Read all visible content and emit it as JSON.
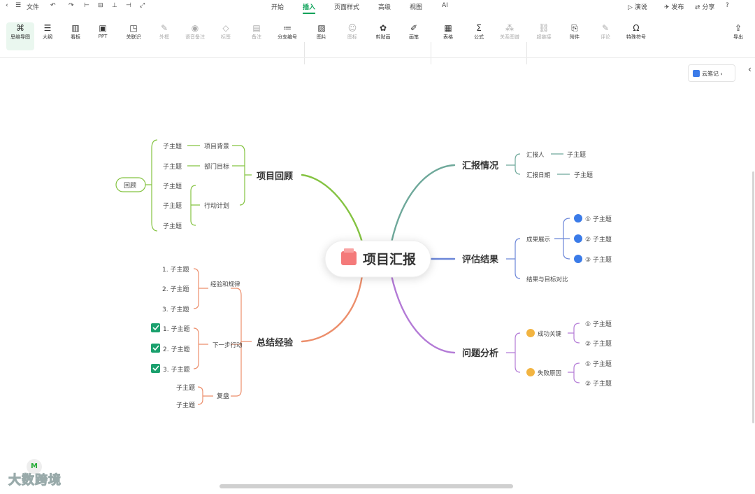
{
  "topbar": {
    "file_label": "文件",
    "tabs": [
      "开始",
      "插入",
      "页面样式",
      "高级",
      "视图",
      "AI"
    ],
    "active_tab": "插入",
    "right_items": [
      "演说",
      "发布",
      "分享"
    ]
  },
  "ribbon": {
    "groups": [
      {
        "label": "思维导图",
        "icon": "⌘"
      },
      {
        "label": "大纲",
        "icon": "☰"
      },
      {
        "label": "看板",
        "icon": "▥"
      },
      {
        "label": "PPT",
        "icon": "▣"
      }
    ],
    "tools": [
      {
        "label": "关联识",
        "icon": "◳"
      },
      {
        "label": "外框",
        "icon": "✎"
      },
      {
        "label": "语音备注",
        "icon": "◉"
      },
      {
        "label": "标签",
        "icon": "◇"
      },
      {
        "label": "备注",
        "icon": "▤"
      },
      {
        "label": "分支编号",
        "icon": "≔"
      },
      {
        "label": "图片",
        "icon": "▨"
      },
      {
        "label": "图标",
        "icon": "☺"
      },
      {
        "label": "剪贴画",
        "icon": "✿"
      },
      {
        "label": "画笔",
        "icon": "✐"
      },
      {
        "label": "表格",
        "icon": "▦"
      },
      {
        "label": "公式",
        "icon": "Σ"
      },
      {
        "label": "关系图谱",
        "icon": "⁂"
      },
      {
        "label": "超链接",
        "icon": "⛓"
      },
      {
        "label": "附件",
        "icon": "⎘"
      },
      {
        "label": "评论",
        "icon": "✎"
      },
      {
        "label": "特殊符号",
        "icon": "Ω"
      }
    ],
    "export_label": "导出",
    "export_icon": "⇪"
  },
  "note_button": {
    "label": "云笔记"
  },
  "watermark": "大数跨境",
  "mindmap": {
    "center": "项目汇报",
    "branches": [
      {
        "title": "项目回顾",
        "color": "#84c341",
        "subs": [
          {
            "text": "项目背景",
            "items": [
              "子主题"
            ]
          },
          {
            "text": "部门目标",
            "items": [
              "子主题"
            ]
          },
          {
            "text": "行动计划",
            "items": [
              "子主题",
              "子主题",
              "子主题"
            ]
          }
        ],
        "extra": "回顾"
      },
      {
        "title": "总结经验",
        "color": "#ec8e6b",
        "subs": [
          {
            "text": "经验和规律",
            "items": [
              "1. 子主题",
              "2. 子主题",
              "3. 子主题"
            ]
          },
          {
            "text": "下一步行动",
            "items": [
              "1. 子主题",
              "2. 子主题",
              "3. 子主题"
            ]
          },
          {
            "text": "复盘",
            "items": [
              "子主题",
              "子主题"
            ]
          }
        ]
      },
      {
        "title": "汇报情况",
        "color": "#6ea89a",
        "subs": [
          {
            "text": "汇报人",
            "items": [
              "子主题"
            ]
          },
          {
            "text": "汇报日期",
            "items": [
              "子主题"
            ]
          }
        ]
      },
      {
        "title": "评估结果",
        "color": "#6b86d8",
        "subs": [
          {
            "text": "成果展示",
            "items": [
              "① 子主题",
              "② 子主题",
              "③ 子主题"
            ]
          },
          {
            "text": "结果与目标对比",
            "items": []
          }
        ]
      },
      {
        "title": "问题分析",
        "color": "#b37ad6",
        "subs": [
          {
            "text": "成功关键",
            "items": [
              "① 子主题",
              "② 子主题"
            ]
          },
          {
            "text": "失败原因",
            "items": [
              "① 子主题",
              "② 子主题"
            ]
          }
        ]
      }
    ]
  }
}
